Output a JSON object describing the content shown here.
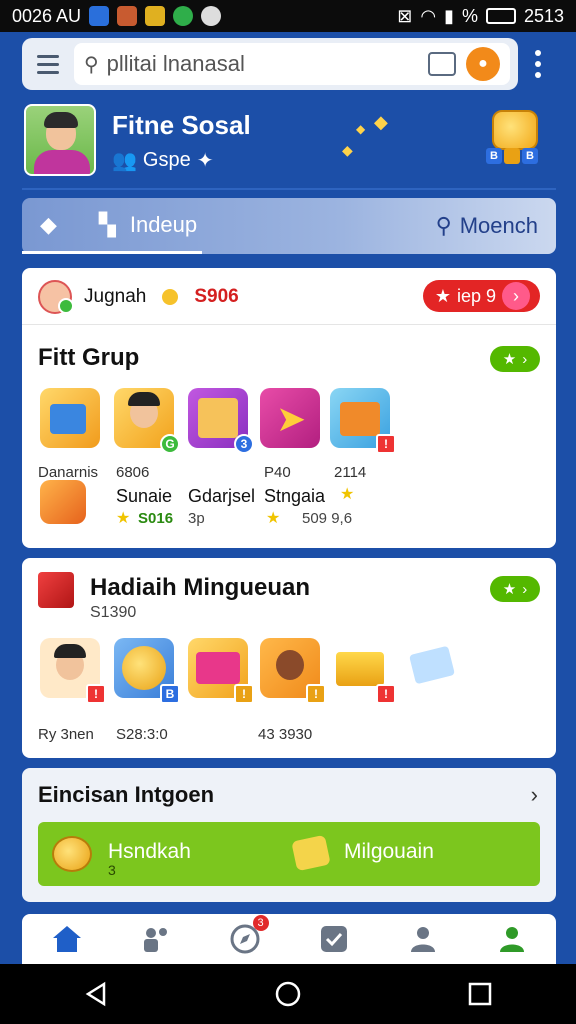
{
  "status_bar": {
    "time_left": "0026 AU",
    "time_right": "2513",
    "battery": "%"
  },
  "search": {
    "placeholder": "pllitai lnanasal"
  },
  "profile": {
    "name": "Fitne Sosal",
    "sub": "Gspe"
  },
  "tabs": [
    {
      "label": "Indeup"
    },
    {
      "label": "Moench"
    }
  ],
  "card1": {
    "user": "Jugnah",
    "amount": "S906",
    "pill_label": "iep 9",
    "title": "Fitt Grup",
    "items": [
      {
        "label": "Danarnis",
        "value": ""
      },
      {
        "label": "6806",
        "value": "",
        "name": "Sunaie",
        "sub": "S016"
      },
      {
        "label": "",
        "value": "",
        "name": "Gdarjsel",
        "sub": "3p"
      },
      {
        "label": "P40",
        "value": ""
      },
      {
        "label": "2114",
        "value": "",
        "name": "Stngaia",
        "sub": "509 9,6"
      }
    ]
  },
  "card2": {
    "title": "Hadiaih Mingueuan",
    "subtitle": "S1390",
    "labels": [
      "Ry 3nen",
      "S28:3:0",
      "43 3930"
    ]
  },
  "card3": {
    "title": "Eincisan Intgoen",
    "bar_left": "Hsndkah",
    "bar_left_sub": "3",
    "bar_right": "Milgouain"
  },
  "nav_badge": "3",
  "colors": {
    "primary": "#1c4fa8",
    "accent_red": "#e32525",
    "accent_green": "#7cc61e"
  }
}
